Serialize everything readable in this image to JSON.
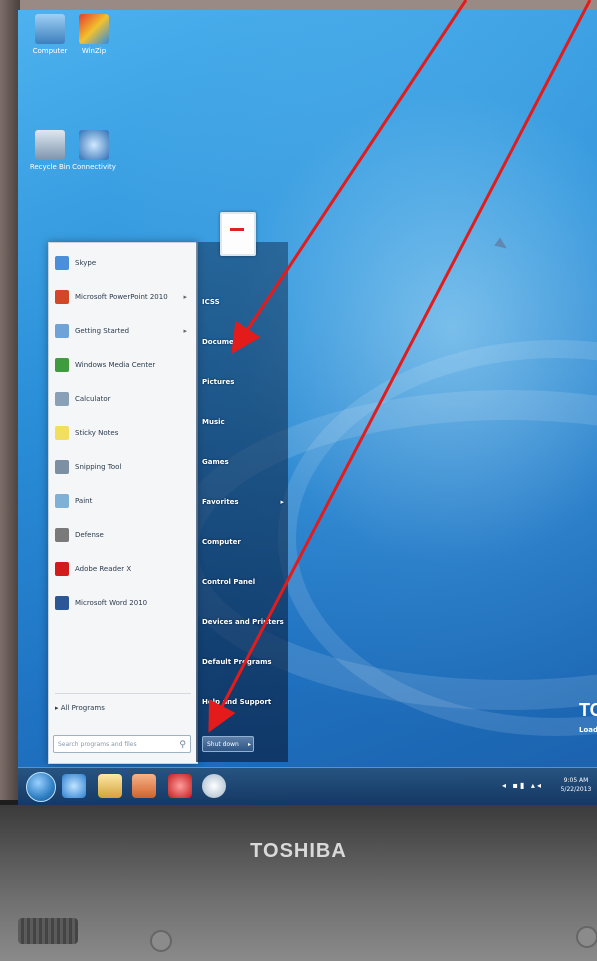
{
  "desktop": {
    "icons": [
      {
        "label": "Computer"
      },
      {
        "label": "WinZip"
      },
      {
        "label": "Recycle Bin"
      },
      {
        "label": "Connectivity"
      }
    ]
  },
  "start_menu": {
    "pinned": [
      {
        "label": "Skype",
        "icon": "skype-icon",
        "color": "#4a8fd8"
      },
      {
        "label": "Microsoft PowerPoint 2010",
        "icon": "powerpoint-icon",
        "color": "#d24726",
        "arrow": true
      },
      {
        "label": "Getting Started",
        "icon": "getting-started-icon",
        "color": "#6fa3d8",
        "arrow": true
      },
      {
        "label": "Windows Media Center",
        "icon": "media-center-icon",
        "color": "#3e9c3e"
      },
      {
        "label": "Calculator",
        "icon": "calculator-icon",
        "color": "#8aa0b6"
      },
      {
        "label": "Sticky Notes",
        "icon": "sticky-notes-icon",
        "color": "#f2df5f"
      },
      {
        "label": "Snipping Tool",
        "icon": "snipping-tool-icon",
        "color": "#7c8fa3"
      },
      {
        "label": "Paint",
        "icon": "paint-icon",
        "color": "#7fb1d6"
      },
      {
        "label": "Defense",
        "icon": "defense-icon",
        "color": "#7a7a7a"
      },
      {
        "label": "Adobe Reader X",
        "icon": "adobe-reader-icon",
        "color": "#d21b1b"
      },
      {
        "label": "Microsoft Word 2010",
        "icon": "word-icon",
        "color": "#2b5797"
      }
    ],
    "all_programs": "All Programs",
    "search_placeholder": "Search programs and files",
    "right_pane": [
      {
        "label": "ICSS"
      },
      {
        "label": "Documents"
      },
      {
        "label": "Pictures"
      },
      {
        "label": "Music"
      },
      {
        "label": "Games"
      },
      {
        "label": "Favorites",
        "arrow": true
      },
      {
        "label": "Computer"
      },
      {
        "label": "Control Panel"
      },
      {
        "label": "Devices and Printers"
      },
      {
        "label": "Default Programs"
      },
      {
        "label": "Help and Support"
      }
    ],
    "shutdown_label": "Shut down"
  },
  "taskbar": {
    "clock_time": "9:05 AM",
    "clock_date": "5/22/2013"
  },
  "splash": {
    "brand": "TOSHIBA",
    "loading": "Loading"
  },
  "bezel_brand": "TOSHIBA",
  "colors": {
    "annotation_arrow": "#e41b1b",
    "desktop_blue": "#2a8fd8"
  }
}
